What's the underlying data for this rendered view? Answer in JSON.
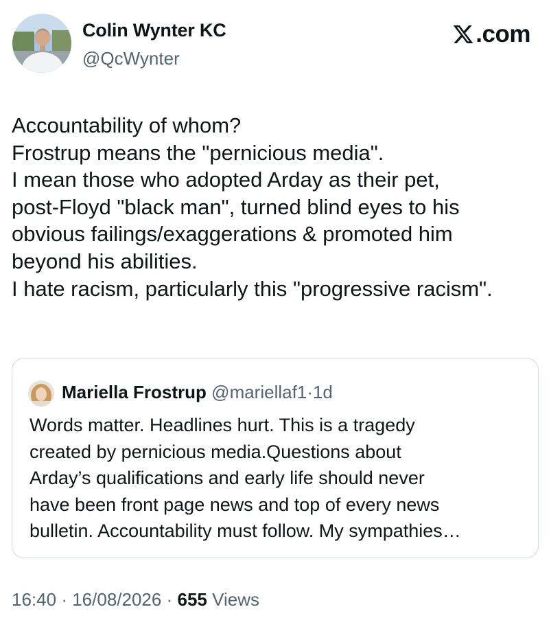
{
  "author": {
    "name": "Colin Wynter KC",
    "handle": "@QcWynter"
  },
  "brand": {
    "logo_icon": "x-logo-icon",
    "suffix": ".com"
  },
  "tweet": {
    "lines": [
      "Accountability of whom?",
      "Frostrup means the \"pernicious media\".",
      "I mean those who adopted Arday as their pet,",
      "post-Floyd \"black man\", turned blind eyes to his",
      "obvious failings/exaggerations & promoted him",
      "beyond his abilities.",
      "I hate racism, particularly this \"progressive racism\"."
    ]
  },
  "quoted_tweet": {
    "name": "Mariella Frostrup",
    "handle": "@mariellaf1",
    "separator": "·",
    "time": "1d",
    "lines": [
      "Words matter. Headlines hurt. This is a tragedy",
      "created by pernicious media.Questions about",
      "Arday’s qualifications and early life should never",
      "have been front page news and top of every news",
      "bulletin. Accountability must follow. My sympathies…"
    ]
  },
  "meta": {
    "time": "16:40",
    "separator": "·",
    "date": "16/08/2026",
    "views_count": "655",
    "views_label": "Views"
  },
  "colors": {
    "text_primary": "#0f1419",
    "text_secondary": "#536471",
    "border": "#cfd9de",
    "background": "#ffffff"
  }
}
